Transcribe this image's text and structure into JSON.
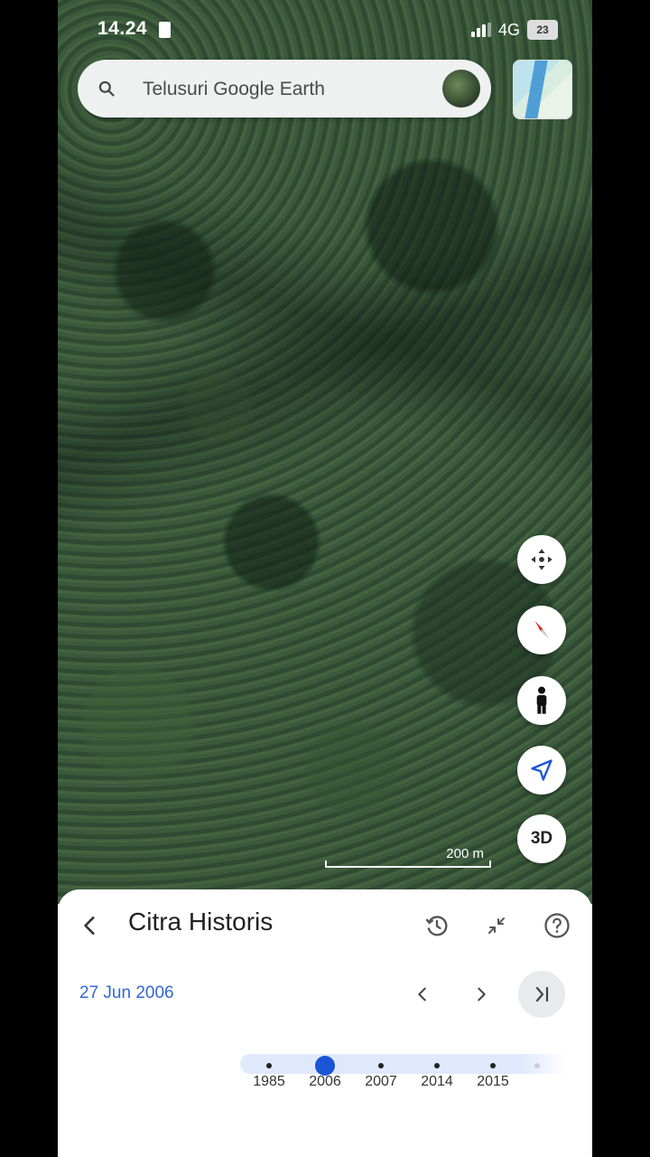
{
  "status_bar": {
    "time": "14.24",
    "network": "4G",
    "battery": "23"
  },
  "search": {
    "placeholder": "Telusuri Google Earth"
  },
  "map": {
    "scale_label": "200 m"
  },
  "controls": {
    "three_d_label": "3D"
  },
  "historical_panel": {
    "title": "Citra Historis",
    "current_date": "27 Jun 2006",
    "timeline": {
      "years": [
        "1985",
        "2006",
        "2007",
        "2014",
        "2015"
      ],
      "selected_year": "2006"
    }
  },
  "colors": {
    "accent": "#1a55d6",
    "date_text": "#3367d6"
  }
}
